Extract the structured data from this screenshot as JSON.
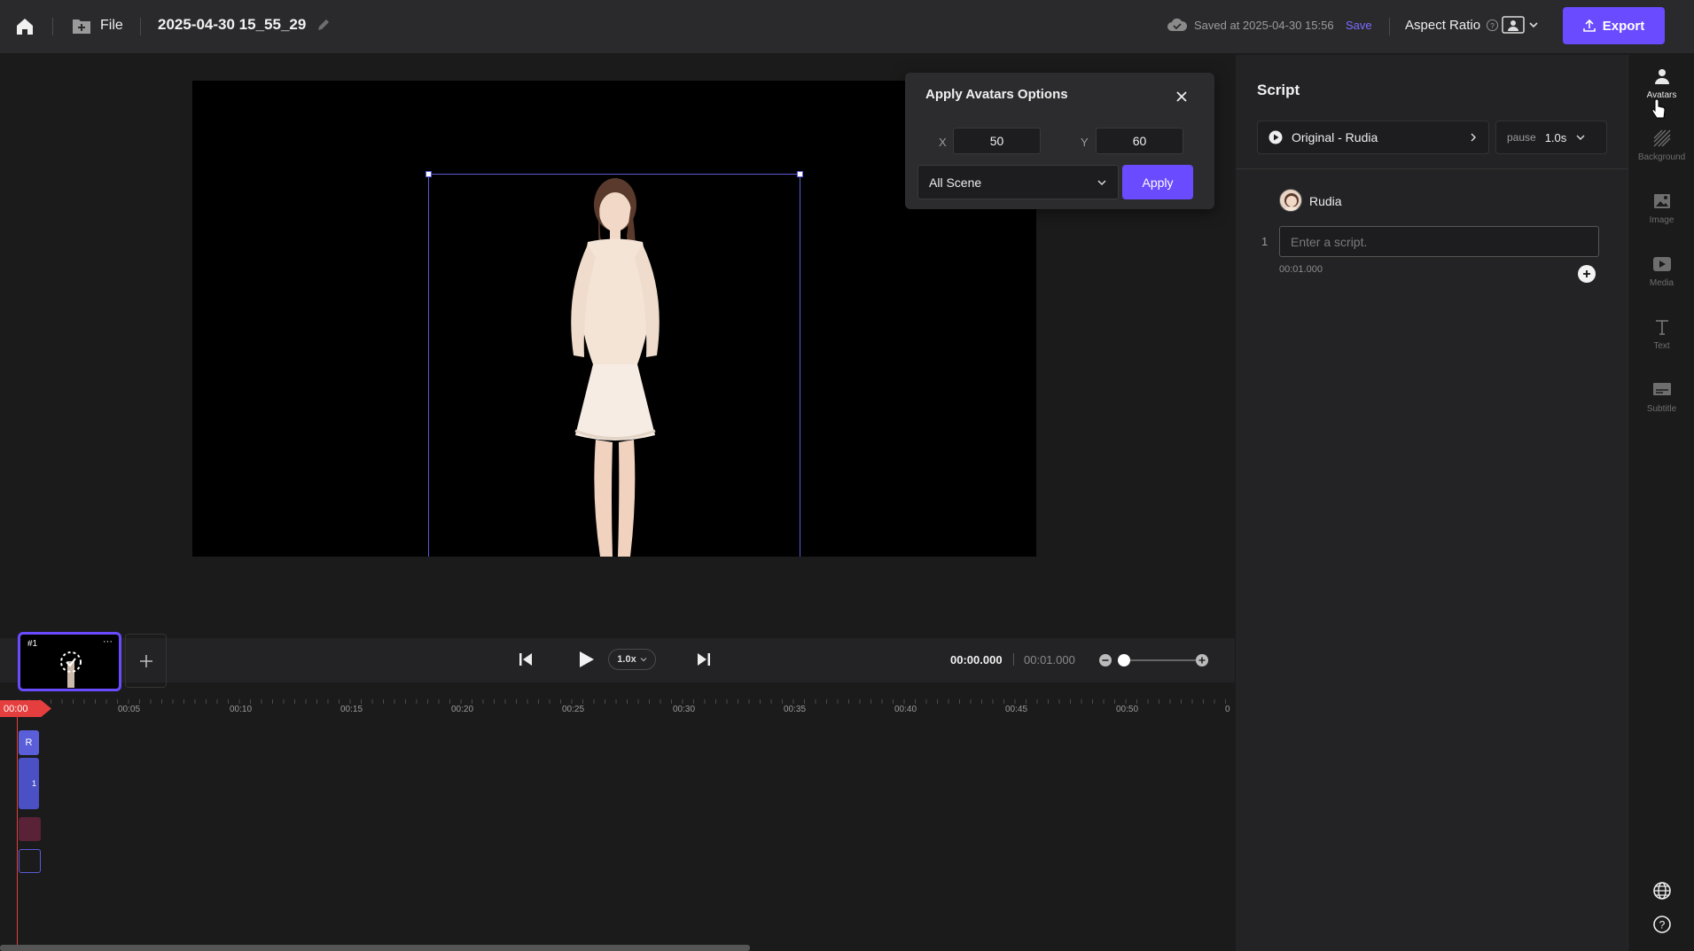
{
  "header": {
    "file_label": "File",
    "project_title": "2025-04-30 15_55_29",
    "saved_text": "Saved at 2025-04-30 15:56",
    "save_label": "Save",
    "aspect_label": "Aspect Ratio",
    "export_label": "Export"
  },
  "popup": {
    "title": "Apply Avatars Options",
    "x_label": "X",
    "x_value": "50",
    "y_label": "Y",
    "y_value": "60",
    "scene_select": "All Scene",
    "apply_label": "Apply"
  },
  "player": {
    "speed": "1.0x",
    "current_time": "00:00.000",
    "total_time": "00:01.000"
  },
  "timeline": {
    "scene_number": "#1",
    "scene_menu": "···",
    "playhead_time": "00:00",
    "ticks": [
      "00:05",
      "00:10",
      "00:15",
      "00:20",
      "00:25",
      "00:30",
      "00:35",
      "00:40",
      "00:45",
      "00:50",
      "0"
    ],
    "avatar_clip_label": "R",
    "script_clip_label": "1"
  },
  "script": {
    "title": "Script",
    "voice_label": "Original - Rudia",
    "pause_label": "pause",
    "pause_value": "1.0s",
    "avatar_name": "Rudia",
    "line_number": "1",
    "placeholder": "Enter a script.",
    "line_time": "00:01.000"
  },
  "rightbar": {
    "items": [
      {
        "label": "Avatars",
        "icon": "person-icon"
      },
      {
        "label": "Background",
        "icon": "hatch-icon"
      },
      {
        "label": "Image",
        "icon": "image-icon"
      },
      {
        "label": "Media",
        "icon": "play-icon"
      },
      {
        "label": "Text",
        "icon": "text-icon"
      },
      {
        "label": "Subtitle",
        "icon": "subtitle-icon"
      }
    ]
  },
  "colors": {
    "accent": "#6a4bff",
    "playhead": "#e53e3e",
    "background": "#1b1b1c",
    "panel": "#232325"
  }
}
